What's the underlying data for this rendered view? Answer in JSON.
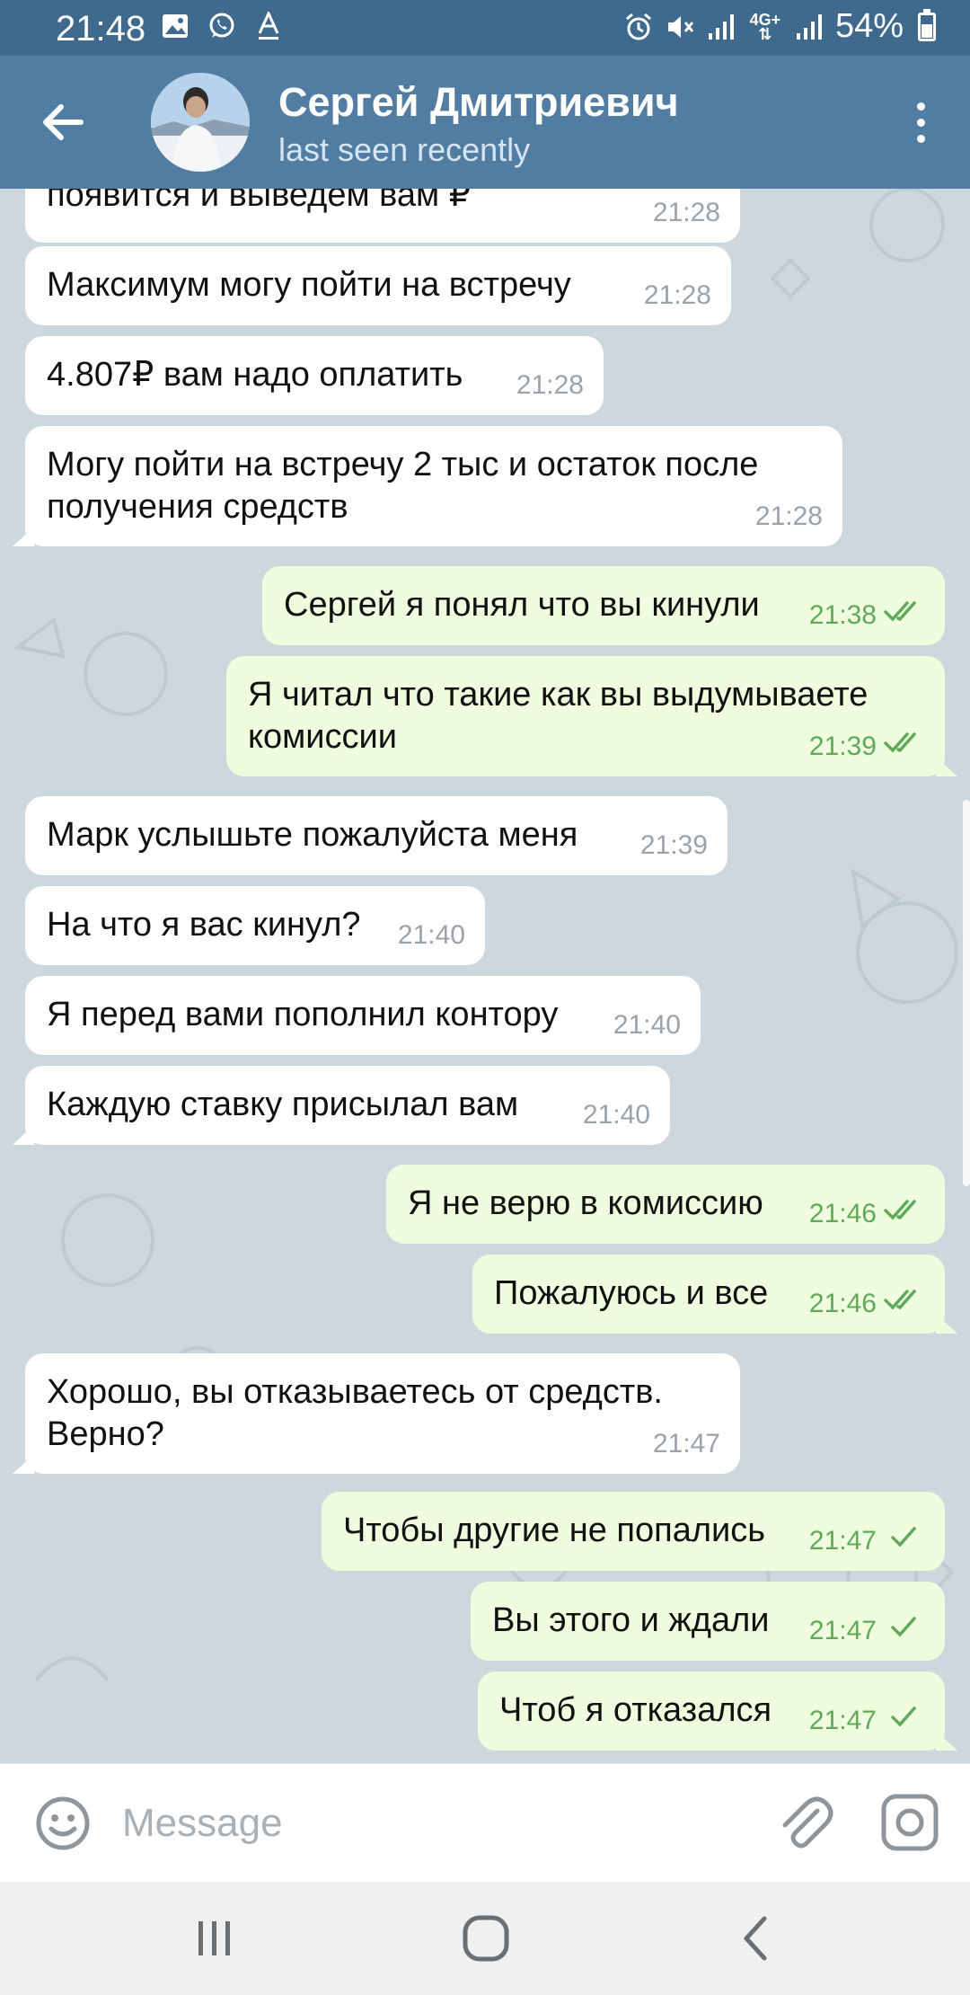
{
  "status_bar": {
    "time": "21:48",
    "network": "4G+",
    "battery": "54%",
    "battery_level": 0.54,
    "icons": [
      "gallery-icon",
      "whatsapp-icon",
      "font-icon",
      "alarm-icon",
      "mute-icon",
      "signal-icon",
      "battery-icon"
    ]
  },
  "header": {
    "title": "Сергей Дмитриевич",
    "status": "last seen recently",
    "icons": [
      "back-arrow-icon",
      "avatar",
      "more-vertical-icon"
    ]
  },
  "messages": [
    {
      "dir": "in",
      "text": "появится и выведем вам ₽",
      "time": "21:28"
    },
    {
      "dir": "in",
      "text": "Максимум могу пойти на встречу",
      "time": "21:28"
    },
    {
      "dir": "in",
      "text": "4.807₽ вам надо оплатить",
      "time": "21:28"
    },
    {
      "dir": "in",
      "text": "Могу пойти на встречу 2 тыс и остаток после\nполучения средств",
      "time": "21:28"
    },
    {
      "dir": "out",
      "text": "Сергей я понял что вы кинули",
      "time": "21:38",
      "read": true
    },
    {
      "dir": "out",
      "text": "Я читал что такие как вы выдумываете\nкомиссии",
      "time": "21:39",
      "read": true
    },
    {
      "dir": "in",
      "text": "Марк услышьте пожалуйста меня",
      "time": "21:39"
    },
    {
      "dir": "in",
      "text": "На что я вас кинул?",
      "time": "21:40"
    },
    {
      "dir": "in",
      "text": "Я перед вами пополнил контору",
      "time": "21:40"
    },
    {
      "dir": "in",
      "text": "Каждую ставку присылал вам",
      "time": "21:40"
    },
    {
      "dir": "out",
      "text": "Я не верю в комиссию",
      "time": "21:46",
      "read": true
    },
    {
      "dir": "out",
      "text": "Пожалуюсь и все",
      "time": "21:46",
      "read": true
    },
    {
      "dir": "in",
      "text": "Хорошо, вы отказываетесь от средств.\nВерно?",
      "time": "21:47"
    },
    {
      "dir": "out",
      "text": "Чтобы другие не попались",
      "time": "21:47",
      "read": false
    },
    {
      "dir": "out",
      "text": "Вы этого и ждали",
      "time": "21:47",
      "read": false
    },
    {
      "dir": "out",
      "text": "Чтоб я отказался",
      "time": "21:47",
      "read": false
    }
  ],
  "input": {
    "placeholder": "Message",
    "icons": [
      "emoji-icon",
      "attach-icon",
      "camera-icon"
    ]
  },
  "nav_bar": {
    "icons": [
      "recent-apps-icon",
      "home-icon",
      "back-icon"
    ]
  },
  "colors": {
    "status_bar": "#3f6a8e",
    "header": "#517da2",
    "incoming_bubble": "#ffffff",
    "outgoing_bubble": "#effdde",
    "outgoing_time": "#5faa5a",
    "chat_background": "#cdd7de"
  }
}
